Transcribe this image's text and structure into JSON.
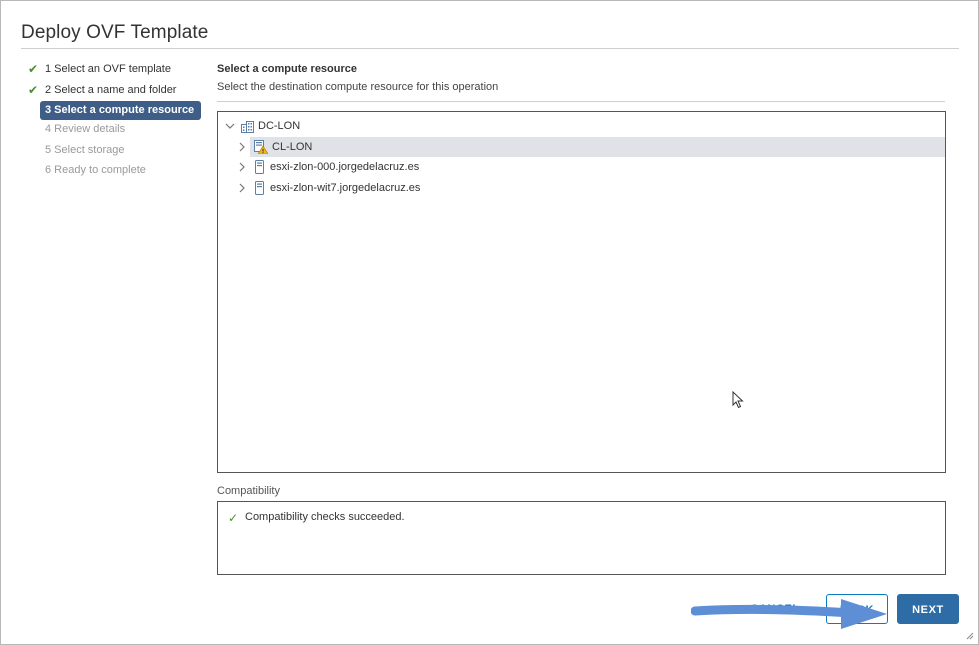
{
  "dialog": {
    "title": "Deploy OVF Template"
  },
  "steps": [
    {
      "label": "1 Select an OVF template",
      "state": "done"
    },
    {
      "label": "2 Select a name and folder",
      "state": "done"
    },
    {
      "label": "3 Select a compute resource",
      "state": "current"
    },
    {
      "label": "4 Review details",
      "state": "pending"
    },
    {
      "label": "5 Select storage",
      "state": "pending"
    },
    {
      "label": "6 Ready to complete",
      "state": "pending"
    }
  ],
  "section": {
    "title": "Select a compute resource",
    "subtitle": "Select the destination compute resource for this operation"
  },
  "tree": {
    "datacenter": {
      "label": "DC-LON",
      "icon": "datacenter-icon",
      "expanded": true
    },
    "children": [
      {
        "label": "CL-LON",
        "icon": "cluster-warning-icon",
        "selected": true
      },
      {
        "label": "esxi-zlon-000.jorgedelacruz.es",
        "icon": "host-icon"
      },
      {
        "label": "esxi-zlon-wit7.jorgedelacruz.es",
        "icon": "host-icon"
      }
    ]
  },
  "compatibility": {
    "label": "Compatibility",
    "message": "Compatibility checks succeeded.",
    "status_color": "#4a8f2a"
  },
  "footer": {
    "cancel_label": "CANCEL",
    "back_label": "BACK",
    "next_label": "NEXT"
  },
  "colors": {
    "accent": "#2e6ca6",
    "step_active_bg": "#3f5e87",
    "check": "#4a8f2a"
  }
}
